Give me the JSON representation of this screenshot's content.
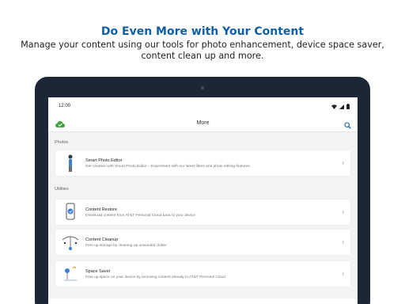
{
  "promo": {
    "title": "Do Even More with Your Content",
    "subtitle_line1": "Manage your content using our tools for photo enhancement, device space saver,",
    "subtitle_line2": "content clean up and more."
  },
  "status_bar": {
    "time": "12:00"
  },
  "app_bar": {
    "title": "More"
  },
  "sections": {
    "photos": "Photos",
    "utilities": "Utilities"
  },
  "cards": [
    {
      "title": "Smart Photo Editor",
      "description": "Get creative with Smart Photo Editor – Experiment with our latest filters and photo editing features."
    },
    {
      "title": "Content Restore",
      "description": "Download content from AT&T Personal Cloud back to your device"
    },
    {
      "title": "Content Cleanup",
      "description": "Free up storage by cleaning up unwanted clutter"
    },
    {
      "title": "Space Saver",
      "description": "Free up space on your device by removing content already in AT&T Personal Cloud"
    }
  ],
  "icons": {
    "cloud": "cloud-check-icon",
    "search": "search-icon",
    "chevron": "chevron-right-icon",
    "wifi": "wifi-icon",
    "signal": "signal-icon",
    "battery": "battery-icon"
  },
  "colors": {
    "accent": "#0f5fa6",
    "brand_green": "#3fa63f",
    "device": "#1b2735"
  }
}
